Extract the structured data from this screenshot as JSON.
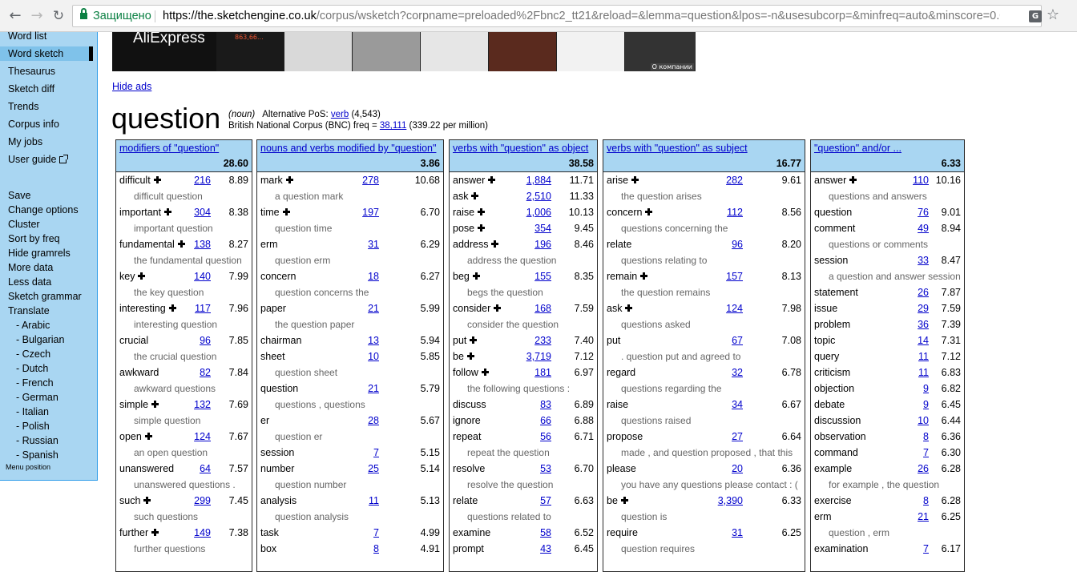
{
  "browser": {
    "secure_label": "Защищено",
    "url_host": "https://the.sketchengine.co.uk",
    "url_path": "/corpus/wsketch?corpname=preloaded%2Fbnc2_tt21&reload=&lemma=question&lpos=-n&usesubcorp=&minfreq=auto&minscore=0.0&..."
  },
  "sidebar": {
    "items": [
      "Word list",
      "Word sketch",
      "Thesaurus",
      "Sketch diff",
      "Trends",
      "Corpus info",
      "My jobs",
      "User guide"
    ],
    "actions": [
      "Save",
      "Change options",
      "Cluster",
      "Sort by freq",
      "Hide gramrels",
      "More data",
      "Less data",
      "Sketch grammar",
      "Translate"
    ],
    "languages": [
      "- Arabic",
      "- Bulgarian",
      "- Czech",
      "- Dutch",
      "- French",
      "- German",
      "- Italian",
      "- Polish",
      "- Russian",
      "- Spanish"
    ],
    "menu_position": "Menu position"
  },
  "ads": {
    "logo": "AliExpress",
    "price": "863,66...",
    "about": "О компании",
    "hide_label": "Hide ads"
  },
  "headword": {
    "lemma": "question",
    "pos": "(noun)",
    "alt_pos_label": "Alternative PoS:",
    "alt_pos": "verb",
    "alt_pos_count": "(4,543)",
    "corpus_label": "British National Corpus (BNC) freq =",
    "freq": "38,111",
    "per_million": "(339.22 per million)"
  },
  "columns": [
    {
      "title": "modifiers of \"question\"",
      "score": "28.60",
      "rows": [
        {
          "word": "difficult",
          "plus": true,
          "freq": "216",
          "score": "8.89",
          "example": "difficult question"
        },
        {
          "word": "important",
          "plus": true,
          "freq": "304",
          "score": "8.38",
          "example": "important question"
        },
        {
          "word": "fundamental",
          "plus": true,
          "freq": "138",
          "score": "8.27",
          "example": "the fundamental question"
        },
        {
          "word": "key",
          "plus": true,
          "freq": "140",
          "score": "7.99",
          "example": "the key question"
        },
        {
          "word": "interesting",
          "plus": true,
          "freq": "117",
          "score": "7.96",
          "example": "interesting question"
        },
        {
          "word": "crucial",
          "plus": false,
          "freq": "96",
          "score": "7.85",
          "example": "the crucial question"
        },
        {
          "word": "awkward",
          "plus": false,
          "freq": "82",
          "score": "7.84",
          "example": "awkward questions"
        },
        {
          "word": "simple",
          "plus": true,
          "freq": "132",
          "score": "7.69",
          "example": "simple question"
        },
        {
          "word": "open",
          "plus": true,
          "freq": "124",
          "score": "7.67",
          "example": "an open question"
        },
        {
          "word": "unanswered",
          "plus": false,
          "freq": "64",
          "score": "7.57",
          "example": "unanswered questions ."
        },
        {
          "word": "such",
          "plus": true,
          "freq": "299",
          "score": "7.45",
          "example": "such questions"
        },
        {
          "word": "further",
          "plus": true,
          "freq": "149",
          "score": "7.38",
          "example": "further questions"
        }
      ]
    },
    {
      "title": "nouns and verbs modified by \"question\"",
      "score": "3.86",
      "rows": [
        {
          "word": "mark",
          "plus": true,
          "freq": "278",
          "score": "10.68",
          "example": "a question mark"
        },
        {
          "word": "time",
          "plus": true,
          "freq": "197",
          "score": "6.70",
          "example": "question time"
        },
        {
          "word": "erm",
          "plus": false,
          "freq": "31",
          "score": "6.29",
          "example": "question erm"
        },
        {
          "word": "concern",
          "plus": false,
          "freq": "18",
          "score": "6.27",
          "example": "question concerns the"
        },
        {
          "word": "paper",
          "plus": false,
          "freq": "21",
          "score": "5.99",
          "example": "the question paper"
        },
        {
          "word": "chairman",
          "plus": false,
          "freq": "13",
          "score": "5.94",
          "example": null
        },
        {
          "word": "sheet",
          "plus": false,
          "freq": "10",
          "score": "5.85",
          "example": "question sheet"
        },
        {
          "word": "question",
          "plus": false,
          "freq": "21",
          "score": "5.79",
          "example": "questions , questions"
        },
        {
          "word": "er",
          "plus": false,
          "freq": "28",
          "score": "5.67",
          "example": "question er"
        },
        {
          "word": "session",
          "plus": false,
          "freq": "7",
          "score": "5.15",
          "example": null
        },
        {
          "word": "number",
          "plus": false,
          "freq": "25",
          "score": "5.14",
          "example": "question number"
        },
        {
          "word": "analysis",
          "plus": false,
          "freq": "11",
          "score": "5.13",
          "example": "question analysis"
        },
        {
          "word": "task",
          "plus": false,
          "freq": "7",
          "score": "4.99",
          "example": null
        },
        {
          "word": "box",
          "plus": false,
          "freq": "8",
          "score": "4.91",
          "example": null
        }
      ]
    },
    {
      "title": "verbs with \"question\" as object",
      "score": "38.58",
      "rows": [
        {
          "word": "answer",
          "plus": true,
          "freq": "1,884",
          "score": "11.71",
          "example": null
        },
        {
          "word": "ask",
          "plus": true,
          "freq": "2,510",
          "score": "11.33",
          "example": null
        },
        {
          "word": "raise",
          "plus": true,
          "freq": "1,006",
          "score": "10.13",
          "example": null
        },
        {
          "word": "pose",
          "plus": true,
          "freq": "354",
          "score": "9.45",
          "example": null
        },
        {
          "word": "address",
          "plus": true,
          "freq": "196",
          "score": "8.46",
          "example": "address the question"
        },
        {
          "word": "beg",
          "plus": true,
          "freq": "155",
          "score": "8.35",
          "example": "begs the question"
        },
        {
          "word": "consider",
          "plus": true,
          "freq": "168",
          "score": "7.59",
          "example": "consider the question"
        },
        {
          "word": "put",
          "plus": true,
          "freq": "233",
          "score": "7.40",
          "example": null
        },
        {
          "word": "be",
          "plus": true,
          "freq": "3,719",
          "score": "7.12",
          "example": null
        },
        {
          "word": "follow",
          "plus": true,
          "freq": "181",
          "score": "6.97",
          "example": "the following questions :"
        },
        {
          "word": "discuss",
          "plus": false,
          "freq": "83",
          "score": "6.89",
          "example": null
        },
        {
          "word": "ignore",
          "plus": false,
          "freq": "66",
          "score": "6.88",
          "example": null
        },
        {
          "word": "repeat",
          "plus": false,
          "freq": "56",
          "score": "6.71",
          "example": "repeat the question"
        },
        {
          "word": "resolve",
          "plus": false,
          "freq": "53",
          "score": "6.70",
          "example": "resolve the question"
        },
        {
          "word": "relate",
          "plus": false,
          "freq": "57",
          "score": "6.63",
          "example": "questions related to"
        },
        {
          "word": "examine",
          "plus": false,
          "freq": "58",
          "score": "6.52",
          "example": null
        },
        {
          "word": "prompt",
          "plus": false,
          "freq": "43",
          "score": "6.45",
          "example": null
        }
      ]
    },
    {
      "title": "verbs with \"question\" as subject",
      "score": "16.77",
      "rows": [
        {
          "word": "arise",
          "plus": true,
          "freq": "282",
          "score": "9.61",
          "example": "the question arises"
        },
        {
          "word": "concern",
          "plus": true,
          "freq": "112",
          "score": "8.56",
          "example": "questions concerning the"
        },
        {
          "word": "relate",
          "plus": false,
          "freq": "96",
          "score": "8.20",
          "example": "questions relating to"
        },
        {
          "word": "remain",
          "plus": true,
          "freq": "157",
          "score": "8.13",
          "example": "the question remains"
        },
        {
          "word": "ask",
          "plus": true,
          "freq": "124",
          "score": "7.98",
          "example": "questions asked"
        },
        {
          "word": "put",
          "plus": false,
          "freq": "67",
          "score": "7.08",
          "example": ". question put and agreed to"
        },
        {
          "word": "regard",
          "plus": false,
          "freq": "32",
          "score": "6.78",
          "example": "questions regarding the"
        },
        {
          "word": "raise",
          "plus": false,
          "freq": "34",
          "score": "6.67",
          "example": "questions raised"
        },
        {
          "word": "propose",
          "plus": false,
          "freq": "27",
          "score": "6.64",
          "example": "made , and question proposed , that this"
        },
        {
          "word": "please",
          "plus": false,
          "freq": "20",
          "score": "6.36",
          "example": "you have any questions please contact : ("
        },
        {
          "word": "be",
          "plus": true,
          "freq": "3,390",
          "score": "6.33",
          "example": "question is"
        },
        {
          "word": "require",
          "plus": false,
          "freq": "31",
          "score": "6.25",
          "example": "question requires"
        }
      ]
    },
    {
      "title": "\"question\" and/or ...",
      "score": "6.33",
      "rows": [
        {
          "word": "answer",
          "plus": true,
          "freq": "110",
          "score": "10.16",
          "example": "questions and answers"
        },
        {
          "word": "question",
          "plus": false,
          "freq": "76",
          "score": "9.01",
          "example": null
        },
        {
          "word": "comment",
          "plus": false,
          "freq": "49",
          "score": "8.94",
          "example": "questions or comments"
        },
        {
          "word": "session",
          "plus": false,
          "freq": "33",
          "score": "8.47",
          "example": "a question and answer session"
        },
        {
          "word": "statement",
          "plus": false,
          "freq": "26",
          "score": "7.87",
          "example": null
        },
        {
          "word": "issue",
          "plus": false,
          "freq": "29",
          "score": "7.59",
          "example": null
        },
        {
          "word": "problem",
          "plus": false,
          "freq": "36",
          "score": "7.39",
          "example": null
        },
        {
          "word": "topic",
          "plus": false,
          "freq": "14",
          "score": "7.31",
          "example": null
        },
        {
          "word": "query",
          "plus": false,
          "freq": "11",
          "score": "7.12",
          "example": null
        },
        {
          "word": "criticism",
          "plus": false,
          "freq": "11",
          "score": "6.83",
          "example": null
        },
        {
          "word": "objection",
          "plus": false,
          "freq": "9",
          "score": "6.82",
          "example": null
        },
        {
          "word": "debate",
          "plus": false,
          "freq": "9",
          "score": "6.45",
          "example": null
        },
        {
          "word": "discussion",
          "plus": false,
          "freq": "10",
          "score": "6.44",
          "example": null
        },
        {
          "word": "observation",
          "plus": false,
          "freq": "8",
          "score": "6.36",
          "example": null
        },
        {
          "word": "command",
          "plus": false,
          "freq": "7",
          "score": "6.30",
          "example": null
        },
        {
          "word": "example",
          "plus": false,
          "freq": "26",
          "score": "6.28",
          "example": "for example , the question"
        },
        {
          "word": "exercise",
          "plus": false,
          "freq": "8",
          "score": "6.28",
          "example": null
        },
        {
          "word": "erm",
          "plus": false,
          "freq": "21",
          "score": "6.25",
          "example": "question , erm"
        },
        {
          "word": "examination",
          "plus": false,
          "freq": "7",
          "score": "6.17",
          "example": null
        }
      ]
    }
  ]
}
